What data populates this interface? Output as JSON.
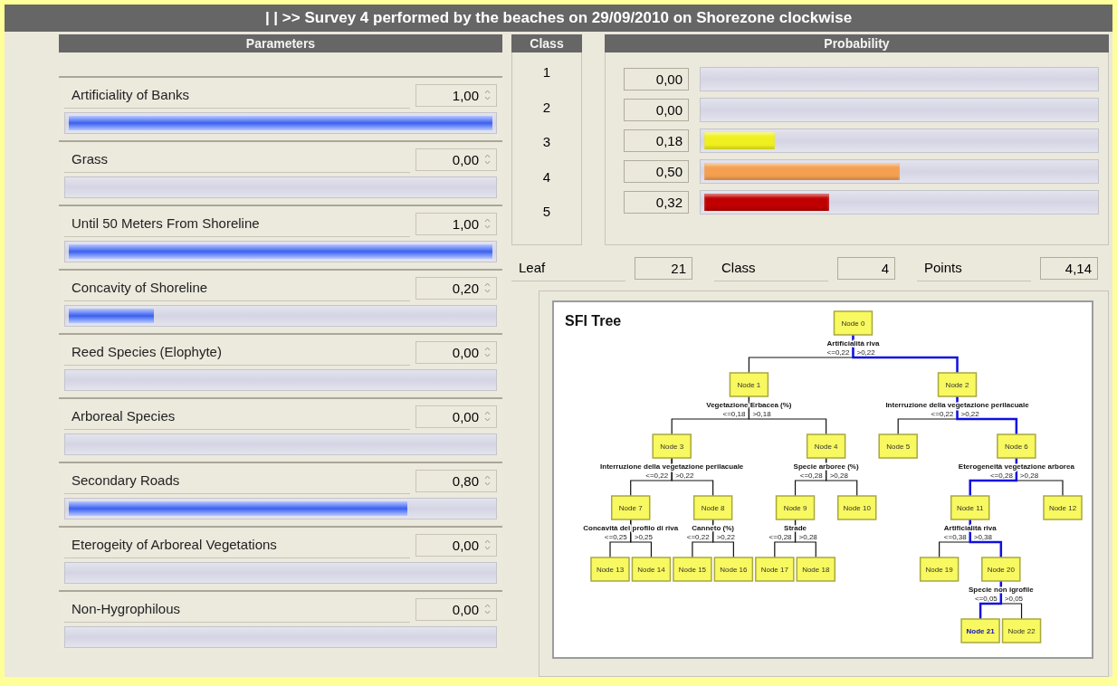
{
  "title": "| | >> Survey 4 performed by the beaches on 29/09/2010 on Shorezone clockwise",
  "parameters_header": "Parameters",
  "parameters": [
    {
      "name": "Artificiality of Banks",
      "value": "1,00",
      "level": 1.0
    },
    {
      "name": "Grass",
      "value": "0,00",
      "level": 0
    },
    {
      "name": "Until 50 Meters From Shoreline",
      "value": "1,00",
      "level": 1.0
    },
    {
      "name": "Concavity of Shoreline",
      "value": "0,20",
      "level": 0.2
    },
    {
      "name": "Reed Species (Elophyte)",
      "value": "0,00",
      "level": 0
    },
    {
      "name": "Arboreal Species",
      "value": "0,00",
      "level": 0
    },
    {
      "name": "Secondary Roads",
      "value": "0,80",
      "level": 0.8
    },
    {
      "name": "Eterogeity of Arboreal Vegetations",
      "value": "0,00",
      "level": 0
    },
    {
      "name": "Non-Hygrophilous",
      "value": "0,00",
      "level": 0
    }
  ],
  "class_header": "Class",
  "probability_header": "Probability",
  "classes": [
    {
      "label": "1",
      "value": "0,00",
      "level": 0
    },
    {
      "label": "2",
      "value": "0,00",
      "level": 0
    },
    {
      "label": "3",
      "value": "0,18",
      "level": 0.18,
      "color": "#f0f020"
    },
    {
      "label": "4",
      "value": "0,50",
      "level": 0.5,
      "color": "#f5a050"
    },
    {
      "label": "5",
      "value": "0,32",
      "level": 0.32,
      "color": "#c00000"
    }
  ],
  "result": [
    {
      "label": "Leaf",
      "value": "21"
    },
    {
      "label": "Class",
      "value": "4"
    },
    {
      "label": "Points",
      "value": "4,14"
    }
  ],
  "tree": {
    "title": "SFI Tree",
    "root": {
      "label": "Node 0",
      "split": "Artificialità riva",
      "left": "<=0,22",
      "right": ">0,22",
      "children": [
        {
          "label": "Node 1",
          "highlighted": false,
          "split": "Vegetazione Erbacea (%)",
          "left": "<=0,18",
          "right": ">0,18",
          "children": [
            {
              "label": "Node 3",
              "highlighted": false,
              "split": "Interruzione della vegetazione perilacuale",
              "left": "<=0,22",
              "right": ">0,22",
              "children": [
                {
                  "label": "Node 7",
                  "highlighted": false,
                  "split": "Concavità del profilo di riva",
                  "left": "<=0,25",
                  "right": ">0,25",
                  "children": [
                    {
                      "label": "Node 13",
                      "highlighted": false
                    },
                    {
                      "label": "Node 14",
                      "highlighted": false
                    }
                  ]
                },
                {
                  "label": "Node 8",
                  "highlighted": false,
                  "split": "Canneto (%)",
                  "left": "<=0,22",
                  "right": ">0,22",
                  "children": [
                    {
                      "label": "Node 15",
                      "highlighted": false
                    },
                    {
                      "label": "Node 16",
                      "highlighted": false
                    }
                  ]
                }
              ]
            },
            {
              "label": "Node 4",
              "highlighted": false,
              "split": "Specie arboree (%)",
              "left": "<=0,28",
              "right": ">0,28",
              "children": [
                {
                  "label": "Node 9",
                  "highlighted": false,
                  "split": "Strade",
                  "left": "<=0,28",
                  "right": ">0,28",
                  "children": [
                    {
                      "label": "Node 17",
                      "highlighted": false
                    },
                    {
                      "label": "Node 18",
                      "highlighted": false
                    }
                  ]
                },
                {
                  "label": "Node 10",
                  "highlighted": false
                }
              ]
            }
          ]
        },
        {
          "label": "Node 2",
          "highlighted": true,
          "split": "Interruzione della vegetazione perilacuale",
          "left": "<=0,22",
          "right": ">0,22",
          "children": [
            {
              "label": "Node 5",
              "highlighted": false
            },
            {
              "label": "Node 6",
              "highlighted": true,
              "split": "Eterogeneità vegetazione arborea",
              "left": "<=0,28",
              "right": ">0,28",
              "children": [
                {
                  "label": "Node 11",
                  "highlighted": true,
                  "split": "Artificialità riva",
                  "left": "<=0,38",
                  "right": ">0,38",
                  "children": [
                    {
                      "label": "Node 19",
                      "highlighted": false
                    },
                    {
                      "label": "Node 20",
                      "highlighted": true,
                      "split": "Specie non igrofile",
                      "left": "<=0,05",
                      "right": ">0,05",
                      "children": [
                        {
                          "label": "Node 21",
                          "highlighted": true
                        },
                        {
                          "label": "Node 22",
                          "highlighted": false
                        }
                      ]
                    }
                  ]
                },
                {
                  "label": "Node 12",
                  "highlighted": false
                }
              ]
            }
          ]
        }
      ]
    }
  }
}
